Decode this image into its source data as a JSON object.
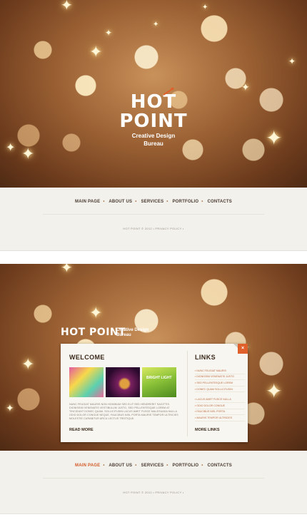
{
  "screen1": {
    "logo": {
      "line1": "HOT",
      "line2": "POINT",
      "tagline1": "Creative Design",
      "tagline2": "Bureau"
    },
    "nav": [
      "MAIN PAGE",
      "ABOUT US",
      "SERVICES",
      "PORTFOLIO",
      "CONTACTS"
    ],
    "footer": "HOT POINT © 2012 • PRIVACY POLICY •"
  },
  "screen2": {
    "logo": {
      "name": "HOT POINT",
      "tagline1": "Creative Design",
      "tagline2": "Bureau"
    },
    "welcome": {
      "title": "WELCOME",
      "thumb3_label": "BRIGHT LIGHT",
      "paragraph": "NUNC FEUGIAT MAURIS NON HOMINUM SED ELIT SED HENDRERIT SAGITTIS. DIGNISSIM VENENATIS VESTIBULUM JUSTO, SED PELLENTESQUE LOREM AT TINCIDUNT DONEC QUAM. SOLLICITUDIN LACUS AMET FUSCE MALESUADA NULLA ODIO DOLOR CONGUE NEQUE. FAUCIBUS NISL PORTA MAURIS TEMPOR ULTRICIES MOLESTIE CURABITUR ARCU LECTUS TRISTIQUE.",
      "read_more": "READ MORE"
    },
    "links": {
      "title": "LINKS",
      "items": [
        "NUNC FEUGIAT MAURIS",
        "DIGNISSIM VENENATIS JUSTO",
        "SED PELLENTESQUE LOREM",
        "DONEC QUAM SOLLICITUDIN",
        "LACUS AMET FUSCE NULLA",
        "ODIO DOLOR CONGUE",
        "FAUCIBUS NISL PORTA",
        "MAURIS TEMPOR ULTRICIES"
      ],
      "more_links": "MORE LINKS",
      "close": "×"
    },
    "nav": [
      "MAIN PAGE",
      "ABOUT US",
      "SERVICES",
      "PORTFOLIO",
      "CONTACTS"
    ],
    "active_nav": "MAIN PAGE",
    "footer": "HOT POINT © 2012 • PRIVACY POLICY •"
  },
  "colors": {
    "accent": "#d35a28",
    "text_dark": "#3b2a1c",
    "strip_bg": "#f2f1ec"
  }
}
